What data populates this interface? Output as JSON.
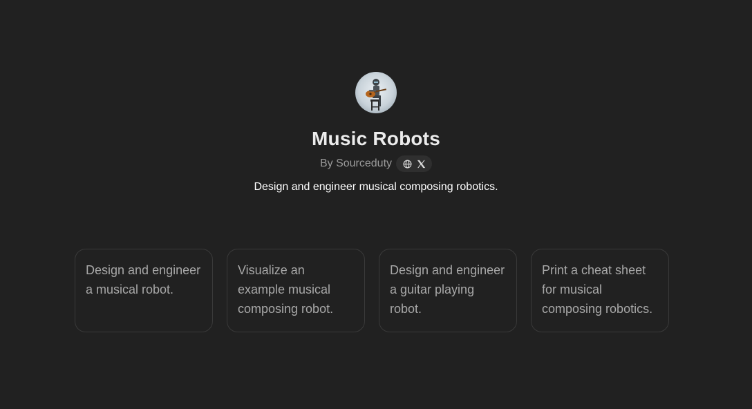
{
  "gpt": {
    "name": "Music Robots",
    "byline": "By Sourceduty",
    "description": "Design and engineer musical composing robotics.",
    "avatar_alt": "robot playing guitar"
  },
  "social": [
    {
      "icon": "globe-icon"
    },
    {
      "icon": "x-logo-icon"
    }
  ],
  "conversation_starters": [
    {
      "label": "Design and engineer a musical robot."
    },
    {
      "label": "Visualize an example musical composing robot."
    },
    {
      "label": "Design and engineer a guitar playing robot."
    },
    {
      "label": "Print a cheat sheet for musical composing robotics."
    }
  ],
  "colors": {
    "background": "#212121",
    "card_border": "#3a3a3a",
    "muted_text": "#9b9b9b"
  }
}
